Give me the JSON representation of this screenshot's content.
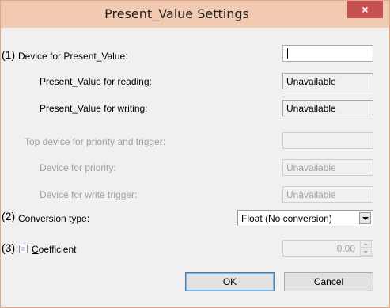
{
  "window": {
    "title": "Present_Value Settings",
    "close_icon": "×"
  },
  "rows": {
    "device_pv": {
      "marker": "(1)",
      "label": "Device for Present_Value:",
      "value": ""
    },
    "pv_reading": {
      "label": "Present_Value for reading:",
      "value": "Unavailable"
    },
    "pv_writing": {
      "label": "Present_Value for writing:",
      "value": "Unavailable"
    },
    "top_device": {
      "label": "Top device for priority and trigger:",
      "value": ""
    },
    "device_priority": {
      "label": "Device for priority:",
      "value": "Unavailable"
    },
    "device_trigger": {
      "label": "Device for write trigger:",
      "value": "Unavailable"
    },
    "conversion": {
      "marker": "(2)",
      "label": "Conversion type:",
      "value": "Float (No conversion)"
    },
    "coefficient": {
      "marker": "(3)",
      "label_first": "C",
      "label_rest": "oefficient",
      "value": "0.00"
    }
  },
  "buttons": {
    "ok": "OK",
    "cancel": "Cancel"
  },
  "colors": {
    "titlebar": "#f2c9b1",
    "close": "#c75050",
    "disabled_text": "#a0a0a0"
  }
}
